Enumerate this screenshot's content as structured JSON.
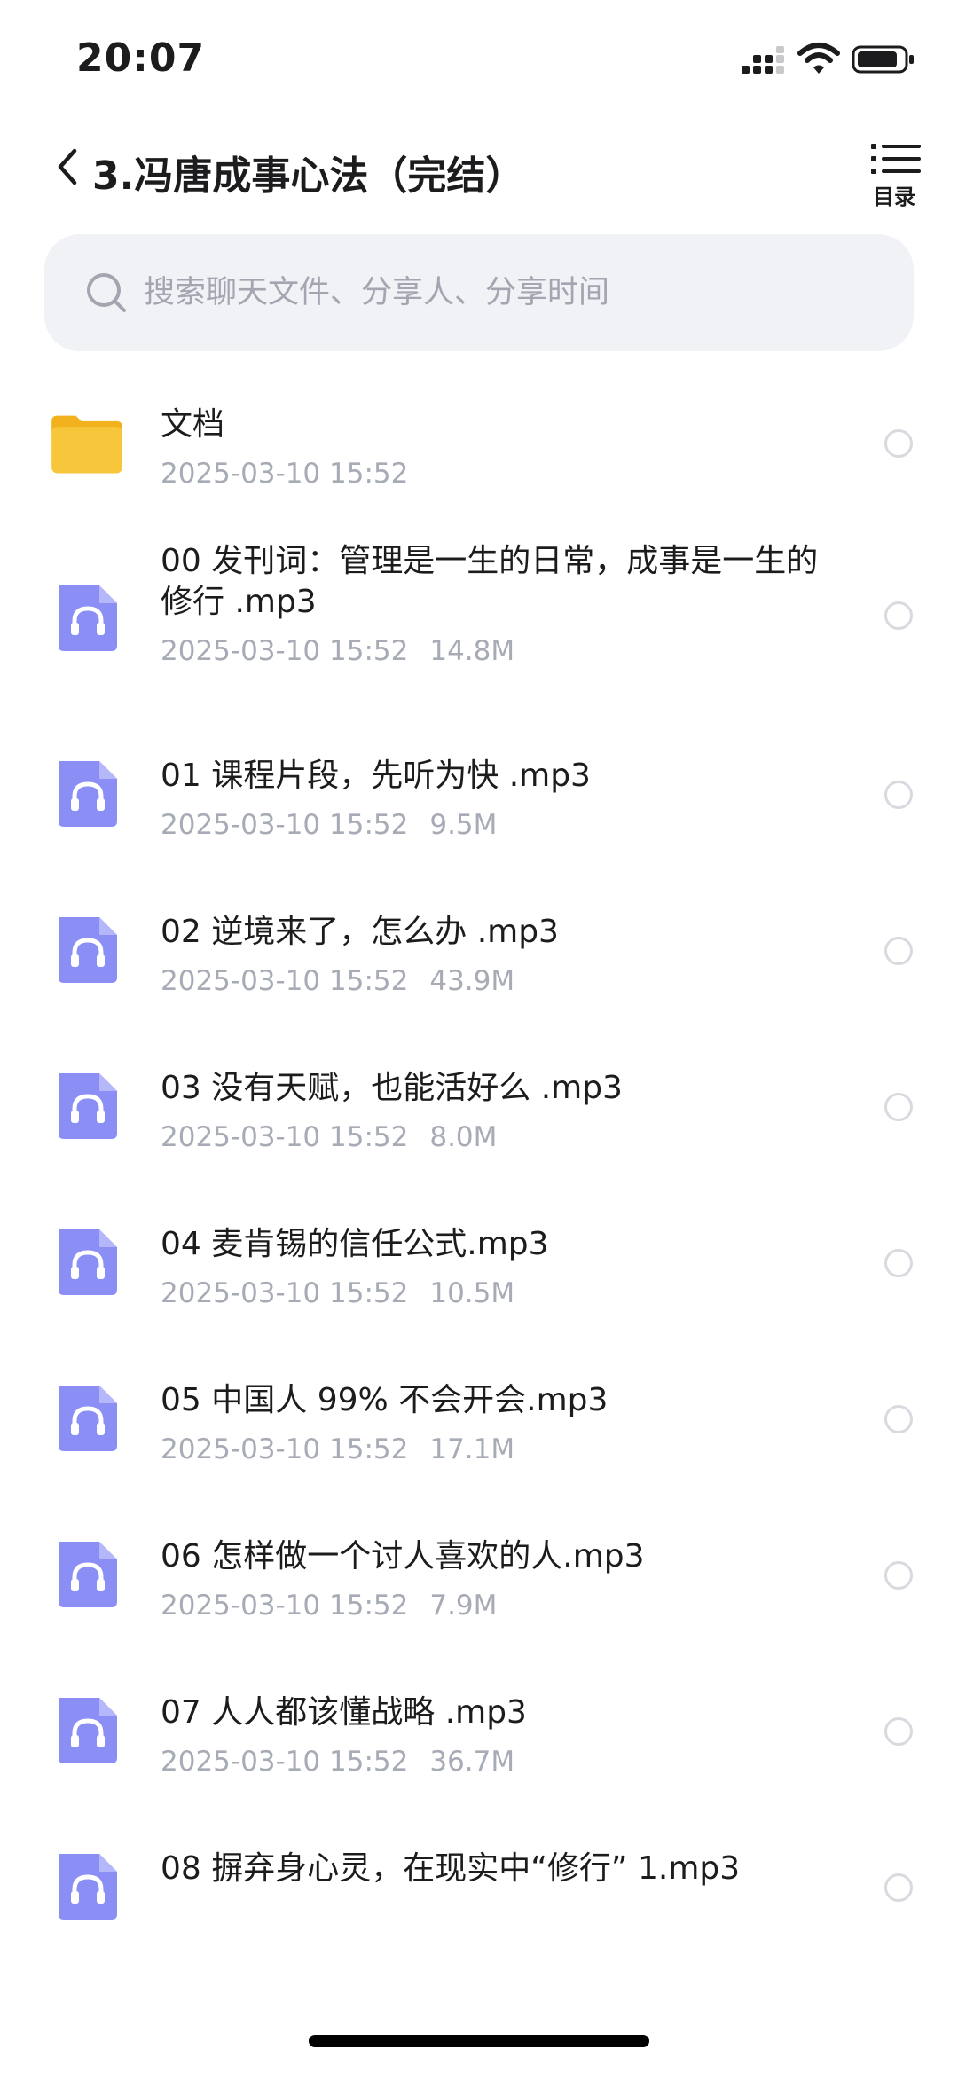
{
  "status_bar": {
    "time": "20:07"
  },
  "header": {
    "title": "3.冯唐成事心法（完结）",
    "toc_label": "目录"
  },
  "search": {
    "placeholder": "搜索聊天文件、分享人、分享时间"
  },
  "files": [
    {
      "name": "文档",
      "date": "2025-03-10 15:52",
      "size": "",
      "type": "folder"
    },
    {
      "name": "00 发刊词：管理是一生的日常，成事是一生的修行 .mp3",
      "date": "2025-03-10 15:52",
      "size": "14.8M",
      "type": "audio"
    },
    {
      "name": "01 课程片段，先听为快 .mp3",
      "date": "2025-03-10 15:52",
      "size": "9.5M",
      "type": "audio"
    },
    {
      "name": "02 逆境来了，怎么办  .mp3",
      "date": "2025-03-10 15:52",
      "size": "43.9M",
      "type": "audio"
    },
    {
      "name": "03 没有天赋，也能活好么 .mp3",
      "date": "2025-03-10 15:52",
      "size": "8.0M",
      "type": "audio"
    },
    {
      "name": "04 麦肯锡的信任公式.mp3",
      "date": "2025-03-10 15:52",
      "size": "10.5M",
      "type": "audio"
    },
    {
      "name": "05 中国人 99% 不会开会.mp3",
      "date": "2025-03-10 15:52",
      "size": "17.1M",
      "type": "audio"
    },
    {
      "name": "06 怎样做一个讨人喜欢的人.mp3",
      "date": "2025-03-10 15:52",
      "size": "7.9M",
      "type": "audio"
    },
    {
      "name": "07 人人都该懂战略  .mp3",
      "date": "2025-03-10 15:52",
      "size": "36.7M",
      "type": "audio"
    },
    {
      "name": "08 摒弃身心灵，在现实中“修行” 1.mp3",
      "date": "",
      "size": "",
      "type": "audio"
    }
  ],
  "colors": {
    "audio_icon": "#8b8ff5",
    "folder_icon": "#f7c63a",
    "search_bg": "#f1f2f6",
    "meta_text": "#a7abb5"
  }
}
